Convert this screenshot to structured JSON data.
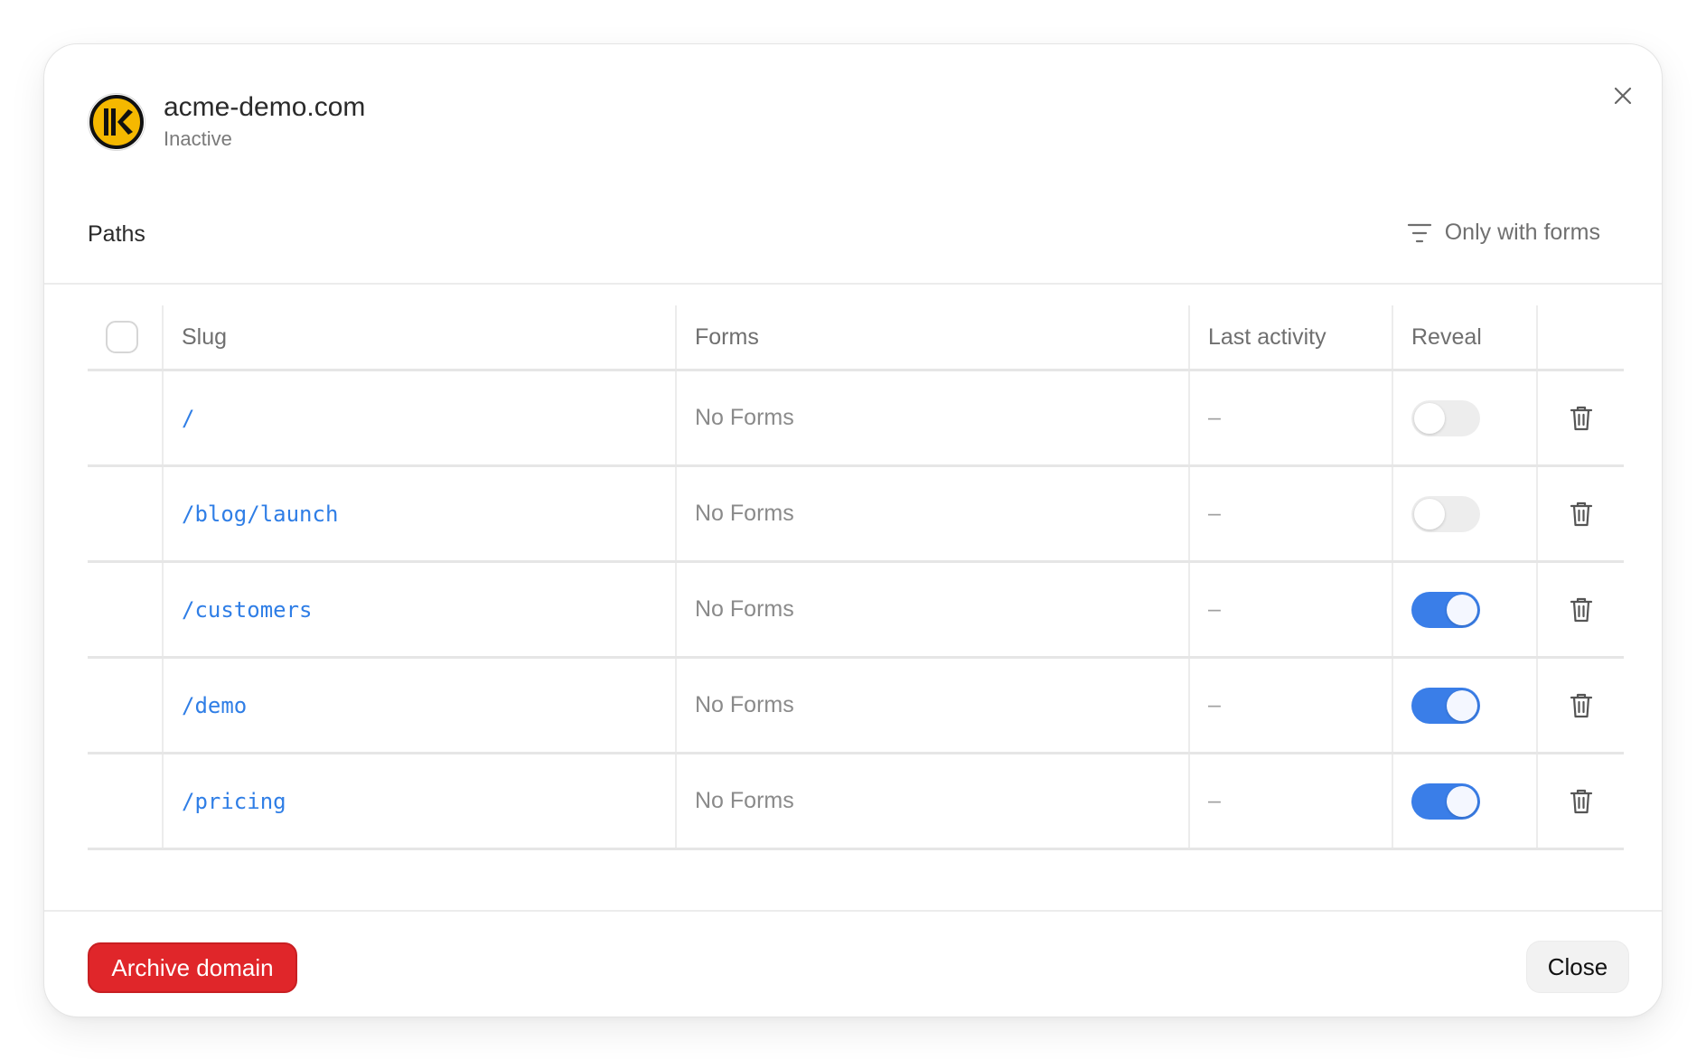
{
  "dialog": {
    "domain": "acme-demo.com",
    "status": "Inactive",
    "logo_icon": "keeper-logo-icon",
    "close_icon": "close-icon"
  },
  "paths_section": {
    "title": "Paths",
    "filter_label": "Only with forms",
    "filter_icon": "filter-icon"
  },
  "table": {
    "columns": [
      "Slug",
      "Forms",
      "Last activity",
      "Reveal"
    ],
    "rows": [
      {
        "slug": "/",
        "forms": "No Forms",
        "last_activity": "–",
        "reveal": false
      },
      {
        "slug": "/blog/launch",
        "forms": "No Forms",
        "last_activity": "–",
        "reveal": false
      },
      {
        "slug": "/customers",
        "forms": "No Forms",
        "last_activity": "–",
        "reveal": true
      },
      {
        "slug": "/demo",
        "forms": "No Forms",
        "last_activity": "–",
        "reveal": true
      },
      {
        "slug": "/pricing",
        "forms": "No Forms",
        "last_activity": "–",
        "reveal": true
      }
    ]
  },
  "footer": {
    "archive_label": "Archive domain",
    "close_label": "Close"
  },
  "colors": {
    "accent": "#3a7ee8",
    "danger": "#e0262a",
    "link": "#2f7ee6",
    "logo_yellow": "#f5b800"
  }
}
